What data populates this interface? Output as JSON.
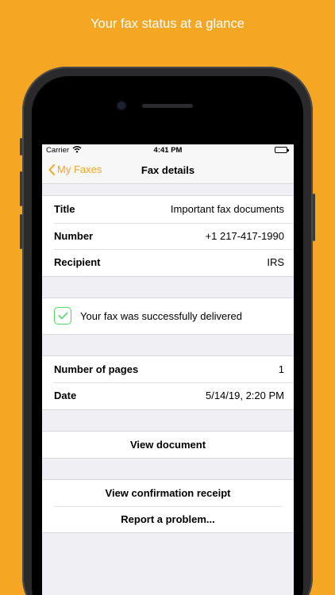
{
  "banner": {
    "headline": "Your fax status at a glance"
  },
  "statusbar": {
    "carrier": "Carrier",
    "time": "4:41 PM"
  },
  "navbar": {
    "back_label": "My Faxes",
    "title": "Fax details"
  },
  "details": [
    {
      "label": "Title",
      "value": "Important fax documents"
    },
    {
      "label": "Number",
      "value": "+1 217-417-1990"
    },
    {
      "label": "Recipient",
      "value": "IRS"
    }
  ],
  "status": {
    "message": "Your fax was successfully delivered",
    "icon": "checkmark-icon",
    "color": "#4CD964"
  },
  "meta": [
    {
      "label": "Number of pages",
      "value": "1"
    },
    {
      "label": "Date",
      "value": "5/14/19, 2:20 PM"
    }
  ],
  "actions": {
    "view_document": "View document",
    "view_receipt": "View confirmation receipt",
    "report_problem": "Report a problem..."
  },
  "colors": {
    "accent": "#F5A623",
    "background": "#EFEFF4",
    "success": "#4CD964"
  }
}
